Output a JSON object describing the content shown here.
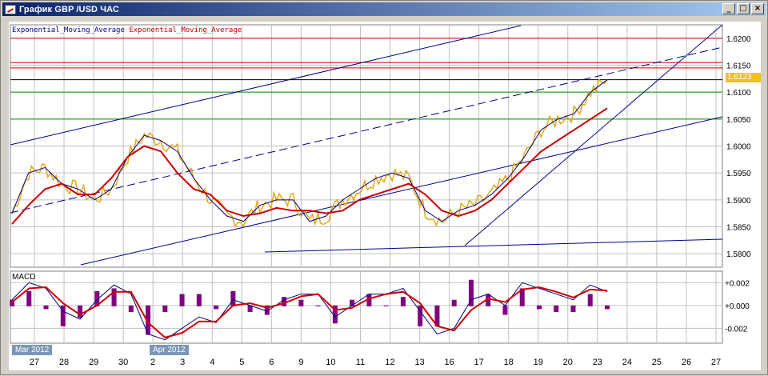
{
  "window": {
    "title": "График GBP /USD  ЧАС",
    "minimize_label": "_",
    "maximize_label": "□",
    "close_label": "×"
  },
  "legend": {
    "indicator_1": "Exponential_Moving_Average",
    "indicator_2": "Exponential_Moving_Average"
  },
  "macd": {
    "label": "MACD"
  },
  "current_price": "1.6123",
  "month_badges": [
    "Mar 2012",
    "Apr 2012"
  ],
  "colors": {
    "price": "#e6a817",
    "ema_fast": "#000080",
    "ema_slow": "#cc0000",
    "trendline": "#00008b",
    "hline_red": "#cc0000",
    "hline_green": "#009900",
    "hline_black": "#000000",
    "macd_hist": "#800080",
    "grid": "#c0c0c0"
  },
  "chart_data": [
    {
      "type": "line",
      "title": "",
      "x": [
        "27",
        "28",
        "29",
        "30",
        "2",
        "3",
        "4",
        "5",
        "6",
        "9",
        "10",
        "11",
        "12",
        "13",
        "16",
        "17",
        "18",
        "19",
        "20",
        "23",
        "24",
        "25",
        "26",
        "27"
      ],
      "y_ticks": [
        "1.6200",
        "1.6150",
        "1.6100",
        "1.6050",
        "1.6000",
        "1.5950",
        "1.5900",
        "1.5850",
        "1.5800"
      ],
      "ylim": [
        1.5775,
        1.6225
      ],
      "horizontal_levels": [
        {
          "value": 1.62,
          "color": "#cc0000"
        },
        {
          "value": 1.6155,
          "color": "#cc0000"
        },
        {
          "value": 1.6145,
          "color": "#cc0000"
        },
        {
          "value": 1.6123,
          "color": "#000000"
        },
        {
          "value": 1.61,
          "color": "#009900"
        },
        {
          "value": 1.605,
          "color": "#009900"
        }
      ],
      "series": [
        {
          "name": "Exponential_Moving_Average",
          "values": [
            1.5875,
            1.595,
            1.596,
            1.593,
            1.592,
            1.59,
            1.592,
            1.598,
            1.602,
            1.601,
            1.599,
            1.594,
            1.59,
            1.587,
            1.586,
            1.589,
            1.59,
            1.59,
            1.586,
            1.587,
            1.59,
            1.592,
            1.594,
            1.595,
            1.594,
            1.588,
            1.586,
            1.588,
            1.589,
            1.591,
            1.594,
            1.598,
            1.603,
            1.605,
            1.606,
            1.61,
            1.6123
          ]
        },
        {
          "name": "Exponential_Moving_Average",
          "values": [
            1.5855,
            1.589,
            1.592,
            1.593,
            1.591,
            1.591,
            1.594,
            1.598,
            1.6,
            1.599,
            1.595,
            1.592,
            1.591,
            1.588,
            1.587,
            1.5875,
            1.5885,
            1.588,
            1.588,
            1.5875,
            1.588,
            1.59,
            1.591,
            1.592,
            1.593,
            1.591,
            1.588,
            1.587,
            1.588,
            1.59,
            1.593,
            1.596,
            1.599,
            1.601,
            1.603,
            1.605,
            1.607
          ]
        }
      ]
    },
    {
      "type": "line",
      "title": "MACD",
      "y_ticks": [
        "+0.002",
        "+0.000",
        "-0.002"
      ],
      "ylim": [
        -0.0033,
        0.003
      ],
      "series": [
        {
          "name": "MACD",
          "values": [
            0.0005,
            0.002,
            0.0015,
            -0.0005,
            -0.0012,
            0.0005,
            0.0018,
            0.001,
            -0.0025,
            -0.003,
            -0.002,
            -0.001,
            -0.0015,
            0.0005,
            0.0,
            -0.0005,
            0.0005,
            0.001,
            0.001,
            -0.001,
            0.0,
            0.001,
            0.001,
            0.0015,
            -0.0005,
            -0.0025,
            -0.002,
            0.0005,
            0.001,
            0.0,
            0.002,
            0.0015,
            0.001,
            0.0005,
            0.0018,
            0.0012
          ]
        },
        {
          "name": "Signal",
          "values": [
            0.0003,
            0.0015,
            0.0016,
            0.0002,
            -0.0008,
            0.0,
            0.0012,
            0.0012,
            -0.0015,
            -0.0028,
            -0.0024,
            -0.0014,
            -0.0014,
            0.0,
            0.0002,
            -0.0002,
            0.0002,
            0.0008,
            0.001,
            -0.0004,
            -0.0002,
            0.0006,
            0.001,
            0.0012,
            0.0002,
            -0.0018,
            -0.0022,
            -0.0004,
            0.0006,
            0.0003,
            0.0014,
            0.0016,
            0.0012,
            0.0007,
            0.0014,
            0.0013
          ]
        }
      ]
    }
  ]
}
